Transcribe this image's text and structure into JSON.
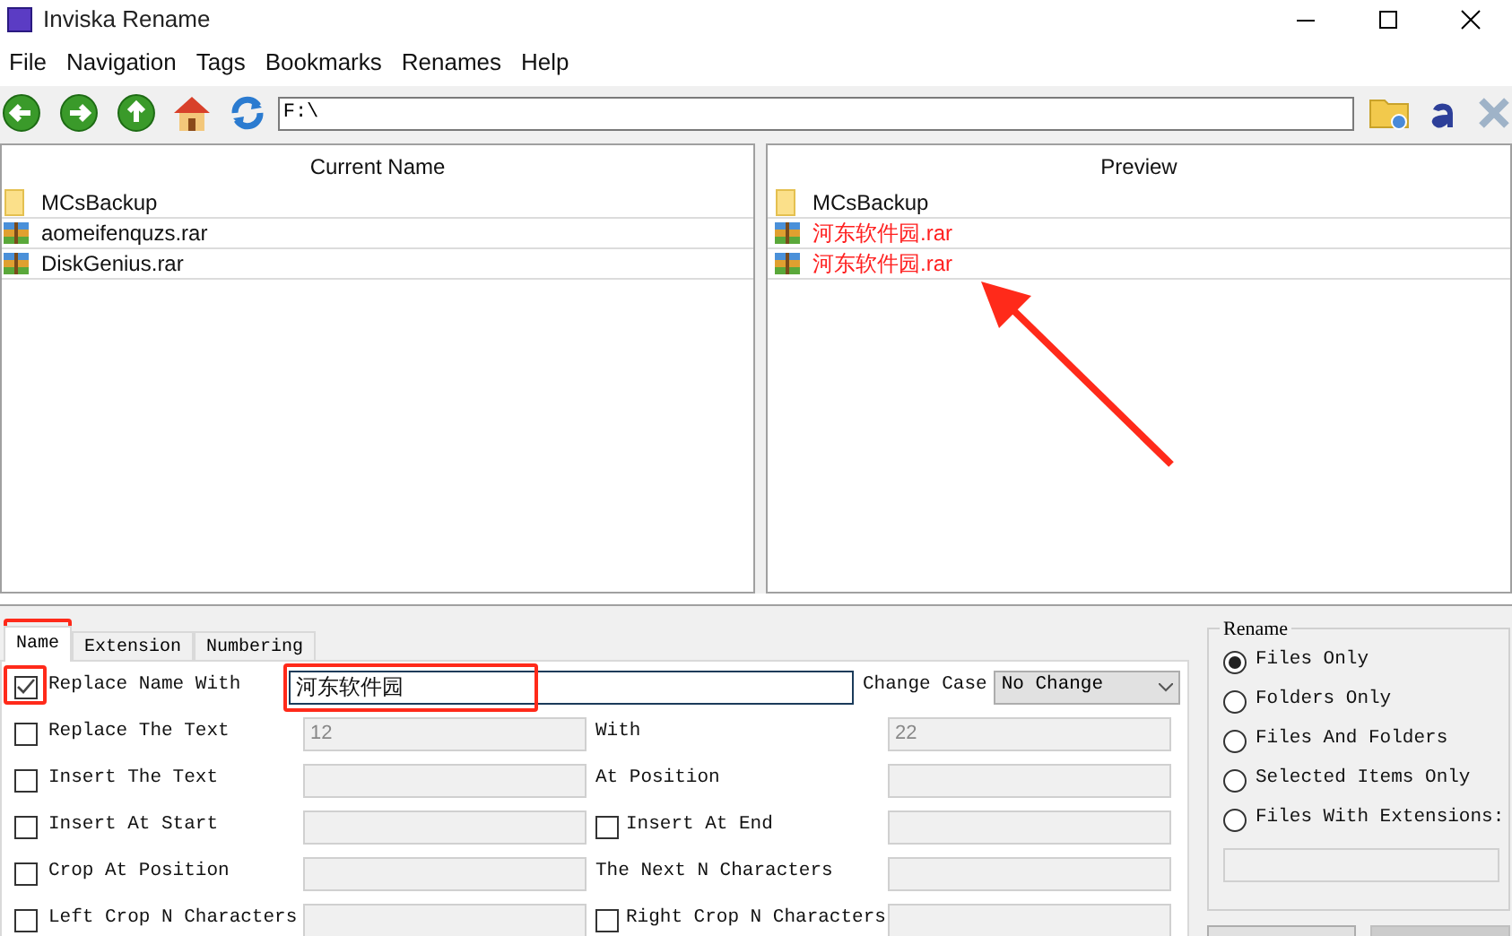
{
  "window": {
    "title": "Inviska Rename"
  },
  "menu": [
    "File",
    "Navigation",
    "Tags",
    "Bookmarks",
    "Renames",
    "Help"
  ],
  "path_field": {
    "value": "F:\\"
  },
  "current_pane": {
    "header": "Current Name",
    "rows": [
      {
        "kind": "folder",
        "name": "MCsBackup",
        "changed": false
      },
      {
        "kind": "archive",
        "name": "aomeifenquzs.rar",
        "changed": false
      },
      {
        "kind": "archive",
        "name": "DiskGenius.rar",
        "changed": false
      }
    ]
  },
  "preview_pane": {
    "header": "Preview",
    "rows": [
      {
        "kind": "folder",
        "name": "MCsBackup",
        "changed": false
      },
      {
        "kind": "archive",
        "name": "河东软件园.rar",
        "changed": true
      },
      {
        "kind": "archive",
        "name": "河东软件园.rar",
        "changed": true
      }
    ]
  },
  "tabs": [
    {
      "label": "Name",
      "selected": true
    },
    {
      "label": "Extension",
      "selected": false
    },
    {
      "label": "Numbering",
      "selected": false
    }
  ],
  "options": [
    {
      "label": "Replace Name With",
      "checked": true,
      "value": "河东软件园",
      "enabled": true,
      "right": {
        "kind": "select",
        "label": "Change Case",
        "value": "No Change"
      }
    },
    {
      "label": "Replace The Text",
      "checked": false,
      "value": "12",
      "enabled": false,
      "right": {
        "kind": "text",
        "label": "With",
        "value": "22"
      }
    },
    {
      "label": "Insert The Text",
      "checked": false,
      "enabled": false,
      "right": {
        "kind": "text",
        "label": "At Position"
      }
    },
    {
      "label": "Insert At Start",
      "checked": false,
      "enabled": false,
      "right": {
        "kind": "checkbox",
        "label": "Insert At End",
        "checked": false
      }
    },
    {
      "label": "Crop At Position",
      "checked": false,
      "enabled": false,
      "right": {
        "kind": "text",
        "label": "The Next N Characters"
      }
    },
    {
      "label": "Left Crop N Characters",
      "checked": false,
      "enabled": false,
      "right": {
        "kind": "checkbox",
        "label": "Right Crop N Characters",
        "checked": false
      }
    }
  ],
  "rename_group": {
    "title": "Rename",
    "choices": [
      {
        "label": "Files Only",
        "selected": true
      },
      {
        "label": "Folders Only",
        "selected": false
      },
      {
        "label": "Files And Folders",
        "selected": false
      },
      {
        "label": "Selected Items Only",
        "selected": false
      },
      {
        "label": "Files With Extensions:",
        "selected": false
      }
    ]
  }
}
